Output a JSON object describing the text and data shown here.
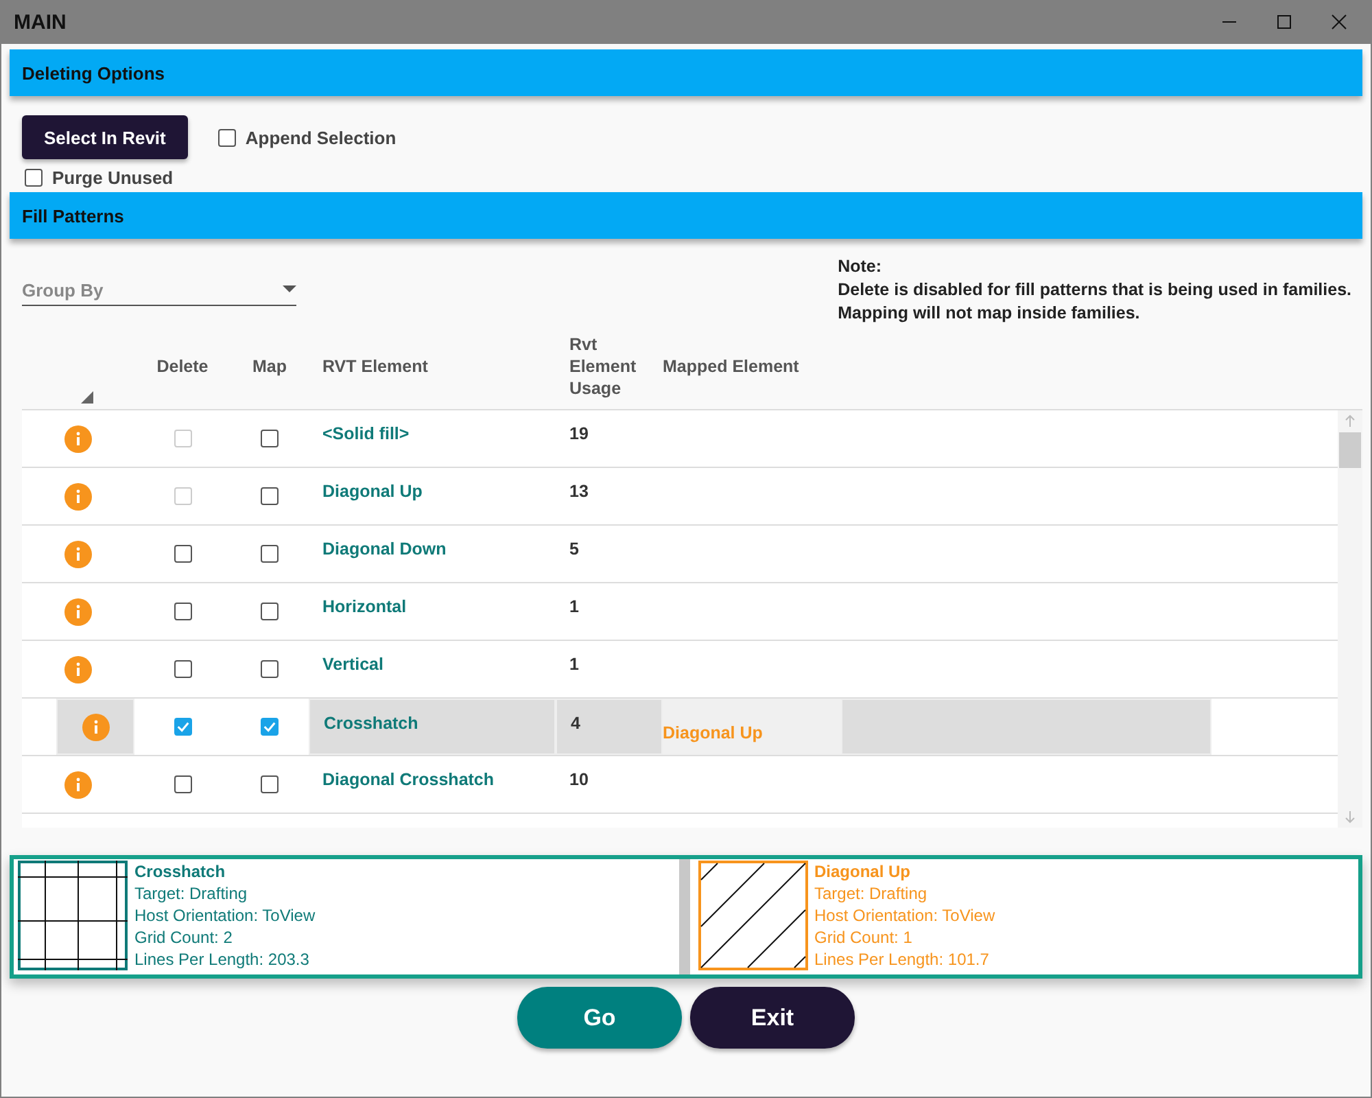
{
  "window": {
    "title": "MAIN"
  },
  "deleting_options": {
    "title": "Deleting Options",
    "select_button": "Select In Revit",
    "append_selection": {
      "label": "Append Selection",
      "checked": false
    },
    "purge_unused": {
      "label": "Purge Unused",
      "checked": false
    }
  },
  "fill_patterns": {
    "title": "Fill Patterns",
    "group_by": {
      "placeholder": "Group By"
    },
    "note": {
      "title": "Note:",
      "lines": [
        "Delete is disabled for fill patterns that is being used in families.",
        "Mapping will not map inside families."
      ]
    }
  },
  "table": {
    "columns": [
      "Delete",
      "Map",
      "RVT Element",
      "Rvt Element Usage",
      "Mapped Element"
    ],
    "rows": [
      {
        "delete": false,
        "delete_disabled": true,
        "map": false,
        "name": "<Solid fill>",
        "usage": "19",
        "selected": false
      },
      {
        "delete": false,
        "delete_disabled": true,
        "map": false,
        "name": "Diagonal Up",
        "usage": "13",
        "selected": false
      },
      {
        "delete": false,
        "delete_disabled": false,
        "map": false,
        "name": "Diagonal Down",
        "usage": "5",
        "selected": false
      },
      {
        "delete": false,
        "delete_disabled": false,
        "map": false,
        "name": "Horizontal",
        "usage": "1",
        "selected": false
      },
      {
        "delete": false,
        "delete_disabled": false,
        "map": false,
        "name": "Vertical",
        "usage": "1",
        "selected": false
      },
      {
        "delete": true,
        "delete_disabled": false,
        "map": true,
        "name": "Crosshatch",
        "usage": "4",
        "mapped": "Diagonal Up",
        "selected": true
      },
      {
        "delete": false,
        "delete_disabled": false,
        "map": false,
        "name": "Diagonal Crosshatch",
        "usage": "10",
        "selected": false
      }
    ]
  },
  "previews": [
    {
      "kind": "crosshatch",
      "name": "Crosshatch",
      "lines": [
        "Target: Drafting",
        "Host Orientation: ToView",
        "Grid Count: 2",
        "Lines Per Length: 203.3"
      ]
    },
    {
      "kind": "diagonal",
      "name": "Diagonal Up",
      "lines": [
        "Target: Drafting",
        "Host Orientation: ToView",
        "Grid Count: 1",
        "Lines Per Length: 101.7"
      ]
    }
  ],
  "buttons": [
    "Go",
    "Exit"
  ]
}
